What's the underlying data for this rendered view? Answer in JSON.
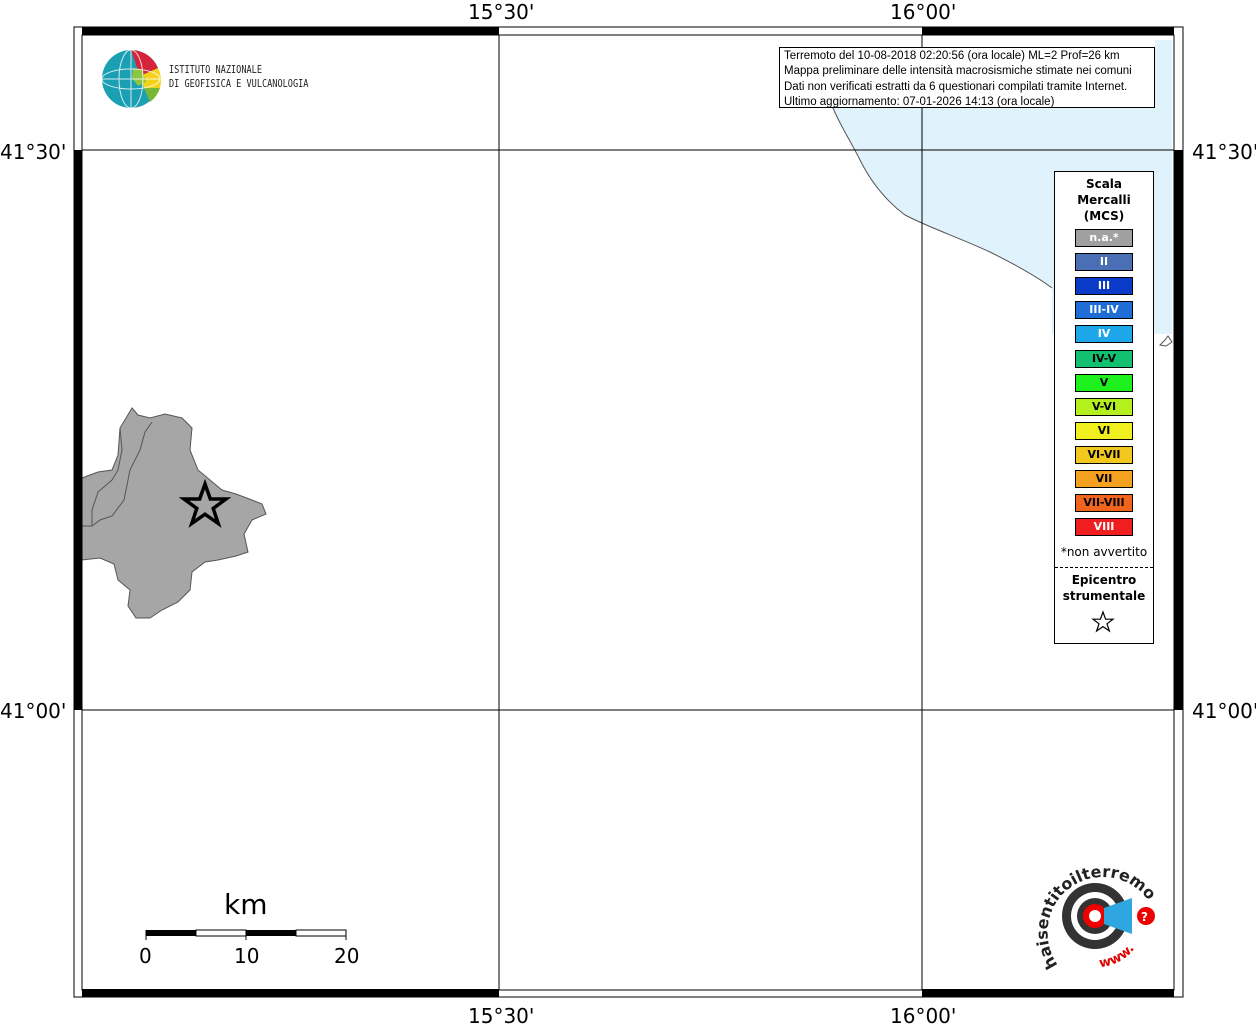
{
  "map": {
    "lon_labels": [
      "15°30'",
      "16°00'"
    ],
    "lat_labels": [
      "41°30'",
      "41°00'"
    ]
  },
  "info": {
    "lines": [
      "Terremoto del 10-08-2018 02:20:56 (ora locale) ML=2 Prof=26 km",
      "Mappa preliminare delle intensità macrosismiche stimate nei comuni",
      "Dati non verificati estratti da 6 questionari compilati tramite Internet.",
      "Ultimo aggiornamento: 07-01-2026 14:13 (ora locale)"
    ]
  },
  "ingv": {
    "line1": "ISTITUTO NAZIONALE",
    "line2": "DI GEOFISICA E VULCANOLOGIA"
  },
  "legend": {
    "title_lines": [
      "Scala",
      "Mercalli",
      "(MCS)"
    ],
    "items": [
      {
        "label": "n.a.*",
        "color": "#a0a0a0",
        "text_color": "#ffffff"
      },
      {
        "label": "II",
        "color": "#4a6fb4",
        "text_color": "#ffffff"
      },
      {
        "label": "III",
        "color": "#0a3ac8",
        "text_color": "#ffffff"
      },
      {
        "label": "III-IV",
        "color": "#1f6ed6",
        "text_color": "#ffffff"
      },
      {
        "label": "IV",
        "color": "#1ea6ea",
        "text_color": "#ffffff"
      },
      {
        "label": "IV-V",
        "color": "#12c070",
        "text_color": "#000000"
      },
      {
        "label": "V",
        "color": "#1ef01e",
        "text_color": "#000000"
      },
      {
        "label": "V-VI",
        "color": "#b4f01e",
        "text_color": "#000000"
      },
      {
        "label": "VI",
        "color": "#f0f01e",
        "text_color": "#000000"
      },
      {
        "label": "VI-VII",
        "color": "#f0c81e",
        "text_color": "#000000"
      },
      {
        "label": "VII",
        "color": "#f5a01e",
        "text_color": "#000000"
      },
      {
        "label": "VII-VIII",
        "color": "#f0641e",
        "text_color": "#000000"
      },
      {
        "label": "VIII",
        "color": "#f01e1e",
        "text_color": "#ffffff"
      }
    ],
    "note": "*non avvertito",
    "epicenter_lines": [
      "Epicentro",
      "strumentale"
    ]
  },
  "scale_bar": {
    "unit": "km",
    "labels": [
      "0",
      "10",
      "20"
    ]
  },
  "hsit": {
    "text": "haisentitoilterremoto.it",
    "url": "www.",
    "question": "?"
  }
}
